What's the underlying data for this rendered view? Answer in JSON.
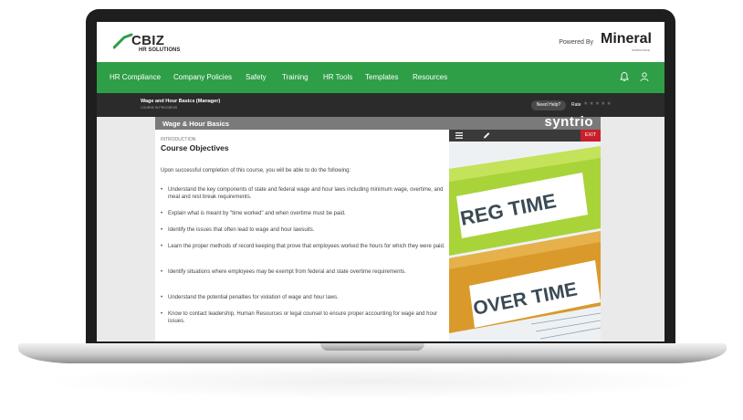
{
  "header": {
    "brand": "CBIZ",
    "brand_sub": "HR SOLUTIONS",
    "powered_by": "Powered By",
    "partner": "Mineral",
    "partner_sub": "WORKFORCE"
  },
  "nav": {
    "items": [
      {
        "label": "HR Compliance"
      },
      {
        "label": "Company Policies"
      },
      {
        "label": "Safety"
      },
      {
        "label": "Training"
      },
      {
        "label": "HR Tools"
      },
      {
        "label": "Templates"
      },
      {
        "label": "Resources"
      }
    ]
  },
  "course_bar": {
    "title": "Wage and Hour Basics (Manager)",
    "status": "COURSE IN PROGRESS",
    "help_label": "Need Help?",
    "rate_label": "Rate",
    "stars": "★★★★★"
  },
  "panel": {
    "title": "Wage & Hour Basics",
    "vendor": "syntrio",
    "exit_label": "EXIT"
  },
  "content": {
    "section": "INTRODUCTION",
    "heading": "Course Objectives",
    "intro": "Upon successful completion of this course, you will be able to do the following:",
    "objectives": [
      "Understand the key components of state and federal wage and hour laws including minimum wage, overtime, and meal and rest break requirements.",
      "Explain what is meant by \"time worked\" and when overtime must be paid.",
      "Identify the issues that often lead to wage and hour lawsuits.",
      "Learn the proper methods of record keeping that prove that employees worked the hours for which they were paid.",
      "Identify situations where employees may be exempt from federal and state overtime requirements.",
      "Understand the potential penalties for violation of wage and hour laws.",
      "Know to contact leadership, Human Resources or legal counsel to ensure proper accounting for wage and hour issues."
    ]
  },
  "image": {
    "label_top": "REG TIME",
    "label_bottom": "OVER TIME"
  },
  "colors": {
    "nav_green": "#2e9e47",
    "exit_red": "#c8202a",
    "folder_green": "#a8d43a"
  }
}
